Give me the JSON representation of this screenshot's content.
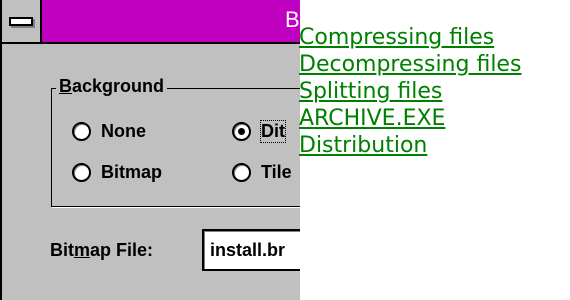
{
  "dialog": {
    "title_fragment": "B",
    "group": {
      "label_accel": "B",
      "label_rest": "ackground"
    },
    "options": [
      {
        "label": "None",
        "checked": false
      },
      {
        "label": "Dit",
        "checked": true
      },
      {
        "label": "Bitmap",
        "checked": false
      },
      {
        "label": "Tile",
        "checked": false
      }
    ],
    "bitmap_file": {
      "label_pre": "Bit",
      "label_accel": "m",
      "label_post": "ap File:",
      "value": "install.br"
    }
  },
  "links": [
    {
      "label": "Compressing files"
    },
    {
      "label": "Decompressing files"
    },
    {
      "label": "Splitting files"
    },
    {
      "label": "ARCHIVE.EXE"
    },
    {
      "label": "Distribution"
    }
  ],
  "colors": {
    "titlebar": "#c000c0",
    "dialog_face": "#c0c0c0",
    "link": "#008000"
  }
}
